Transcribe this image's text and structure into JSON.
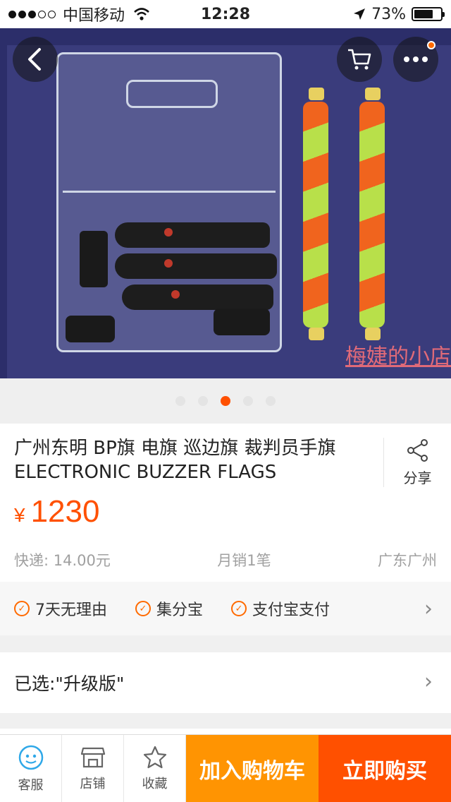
{
  "status_bar": {
    "carrier": "中国移动",
    "time": "12:28",
    "battery": "73%",
    "battery_level": 0.73
  },
  "hero": {
    "watermark": "梅婕的小店",
    "page_count": 5,
    "active_page": 3
  },
  "product": {
    "title": "广州东明 BP旗 电旗 巡边旗 裁判员手旗ELECTRONIC BUZZER FLAGS",
    "currency": "¥",
    "price": "1230",
    "shipping": "快递: 14.00元",
    "monthly_sales": "月销1笔",
    "location": "广东广州",
    "share_label": "分享"
  },
  "services": [
    {
      "label": "7天无理由"
    },
    {
      "label": "集分宝"
    },
    {
      "label": "支付宝支付"
    }
  ],
  "selection": {
    "label": "已选:\"升级版\""
  },
  "bottom_bar": {
    "service_label": "客服",
    "shop_label": "店铺",
    "favorite_label": "收藏",
    "add_cart_label": "加入购物车",
    "buy_now_label": "立即购买"
  },
  "colors": {
    "accent": "#ff5000",
    "cart_button": "#ff9402"
  },
  "icons": [
    "back-arrow-icon",
    "cart-icon",
    "more-icon",
    "share-icon",
    "check-circle-icon",
    "chevron-right-icon",
    "chat-face-icon",
    "shop-icon",
    "star-icon",
    "wifi-icon",
    "location-arrow-icon",
    "battery-icon",
    "signal-dots-icon"
  ]
}
